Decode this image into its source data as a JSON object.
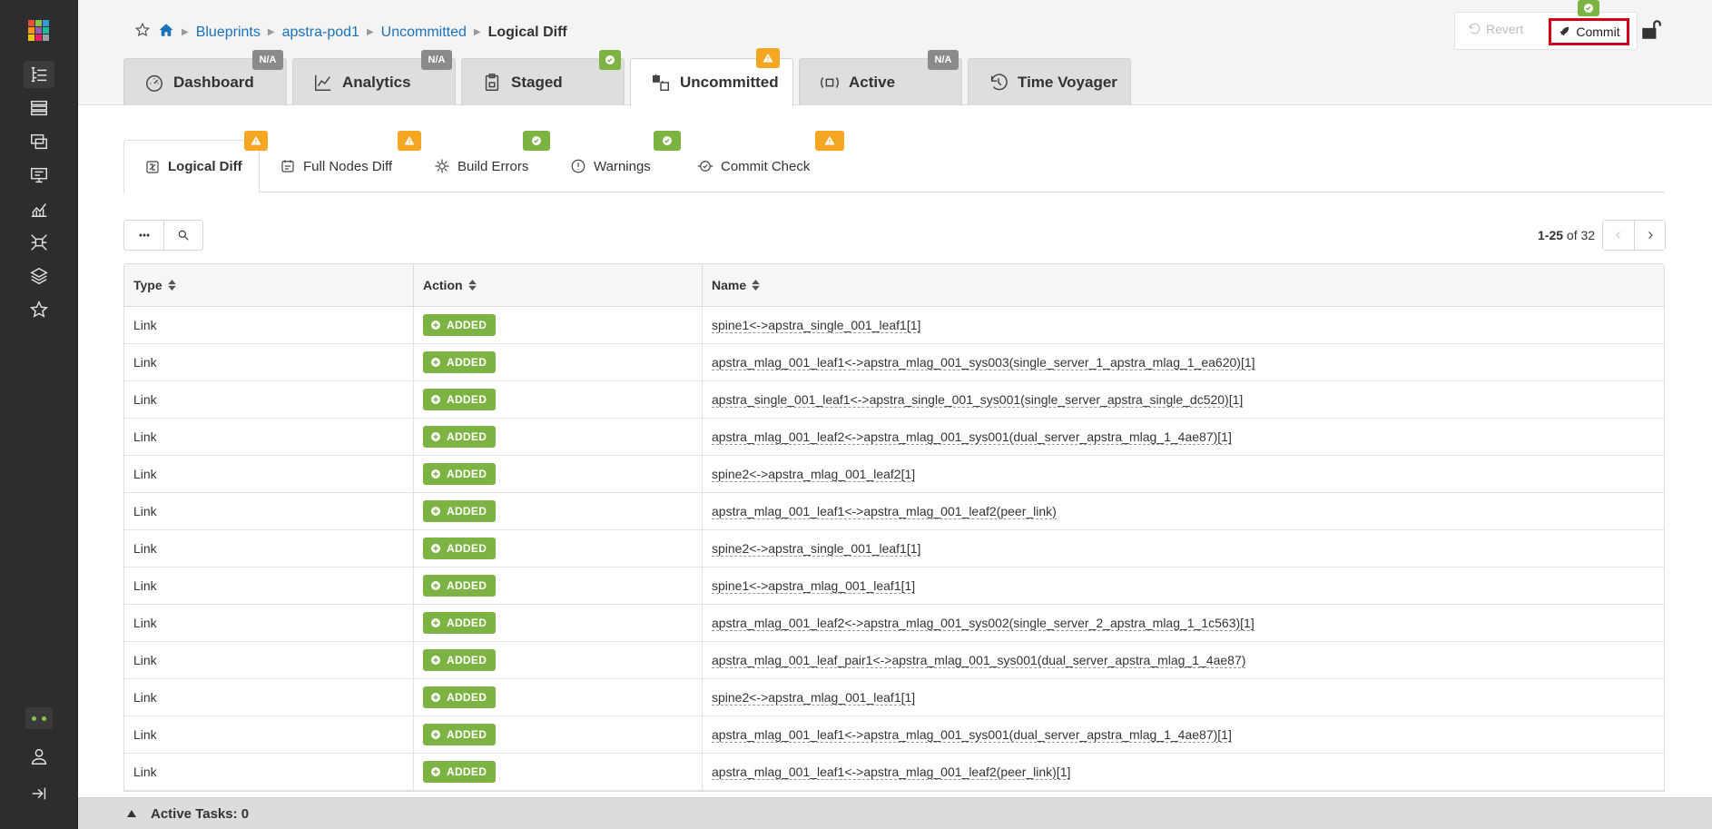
{
  "sidebar": {
    "logo_colors": [
      "#e74c3c",
      "#8bc34a",
      "#3498db",
      "#f39c12",
      "#9b59b6",
      "#1abc9c",
      "#f1c40f",
      "#e91e63",
      "#95a5a6"
    ],
    "icons": [
      "blueprints-icon",
      "devices-icon",
      "design-icon",
      "resources-icon",
      "analytics-icon",
      "external-systems-icon",
      "platform-icon",
      "favorites-icon"
    ]
  },
  "breadcrumb": {
    "items": [
      "Blueprints",
      "apstra-pod1",
      "Uncommitted"
    ],
    "current": "Logical Diff"
  },
  "actions": {
    "revert_label": "Revert",
    "commit_label": "Commit"
  },
  "tabs": [
    {
      "label": "Dashboard",
      "badge": "N/A"
    },
    {
      "label": "Analytics",
      "badge": "N/A"
    },
    {
      "label": "Staged",
      "badge": "ok"
    },
    {
      "label": "Uncommitted",
      "badge": "warn"
    },
    {
      "label": "Active",
      "badge": "N/A"
    },
    {
      "label": "Time Voyager",
      "badge": ""
    }
  ],
  "subtabs": [
    {
      "label": "Logical Diff",
      "badge": "warn"
    },
    {
      "label": "Full Nodes Diff",
      "badge": "warn"
    },
    {
      "label": "Build Errors",
      "badge": "ok"
    },
    {
      "label": "Warnings",
      "badge": "ok"
    },
    {
      "label": "Commit Check",
      "badge": "warn"
    }
  ],
  "pager": {
    "range": "1-25",
    "of": "of 32"
  },
  "table": {
    "columns": [
      "Type",
      "Action",
      "Name"
    ],
    "rows": [
      {
        "type": "Link",
        "action": "ADDED",
        "name": "spine1<->apstra_single_001_leaf1[1]"
      },
      {
        "type": "Link",
        "action": "ADDED",
        "name": "apstra_mlag_001_leaf1<->apstra_mlag_001_sys003(single_server_1_apstra_mlag_1_ea620)[1]"
      },
      {
        "type": "Link",
        "action": "ADDED",
        "name": "apstra_single_001_leaf1<->apstra_single_001_sys001(single_server_apstra_single_dc520)[1]"
      },
      {
        "type": "Link",
        "action": "ADDED",
        "name": "apstra_mlag_001_leaf2<->apstra_mlag_001_sys001(dual_server_apstra_mlag_1_4ae87)[1]"
      },
      {
        "type": "Link",
        "action": "ADDED",
        "name": "spine2<->apstra_mlag_001_leaf2[1]"
      },
      {
        "type": "Link",
        "action": "ADDED",
        "name": "apstra_mlag_001_leaf1<->apstra_mlag_001_leaf2(peer_link)"
      },
      {
        "type": "Link",
        "action": "ADDED",
        "name": "spine2<->apstra_single_001_leaf1[1]"
      },
      {
        "type": "Link",
        "action": "ADDED",
        "name": "spine1<->apstra_mlag_001_leaf1[1]"
      },
      {
        "type": "Link",
        "action": "ADDED",
        "name": "apstra_mlag_001_leaf2<->apstra_mlag_001_sys002(single_server_2_apstra_mlag_1_1c563)[1]"
      },
      {
        "type": "Link",
        "action": "ADDED",
        "name": "apstra_mlag_001_leaf_pair1<->apstra_mlag_001_sys001(dual_server_apstra_mlag_1_4ae87)"
      },
      {
        "type": "Link",
        "action": "ADDED",
        "name": "spine2<->apstra_mlag_001_leaf1[1]"
      },
      {
        "type": "Link",
        "action": "ADDED",
        "name": "apstra_mlag_001_leaf1<->apstra_mlag_001_sys001(dual_server_apstra_mlag_1_4ae87)[1]"
      },
      {
        "type": "Link",
        "action": "ADDED",
        "name": "apstra_mlag_001_leaf1<->apstra_mlag_001_leaf2(peer_link)[1]"
      }
    ]
  },
  "footer": {
    "active_tasks": "Active Tasks: 0"
  },
  "colors": {
    "link": "#1a73b8",
    "added": "#7cb342",
    "warn": "#f5a623",
    "na": "#8a8a8a",
    "commit_highlight": "#d0021b"
  }
}
